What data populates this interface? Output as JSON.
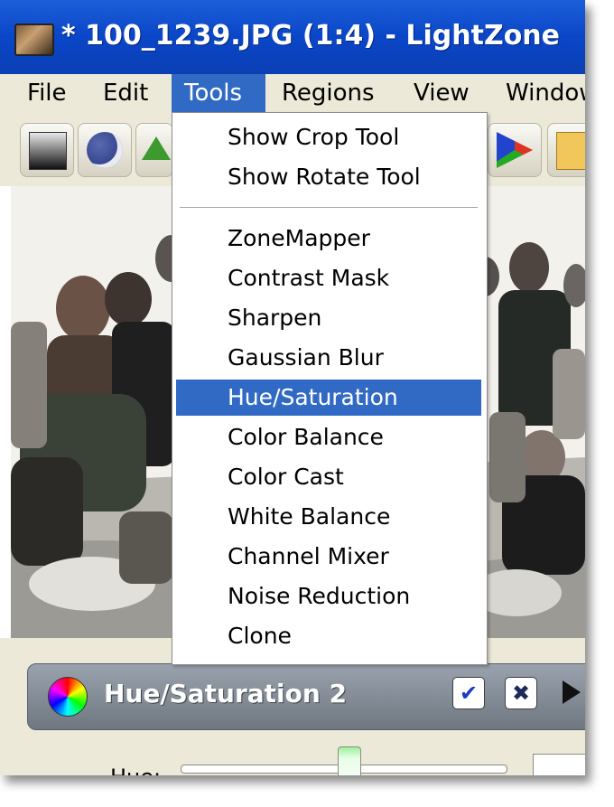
{
  "window": {
    "title": "* 100_1239.JPG (1:4) - LightZone"
  },
  "menubar": {
    "items": [
      {
        "label": "File"
      },
      {
        "label": "Edit"
      },
      {
        "label": "Tools"
      },
      {
        "label": "Regions"
      },
      {
        "label": "View"
      },
      {
        "label": "Window"
      }
    ],
    "open_menu": "Tools"
  },
  "tools_menu": {
    "items": [
      {
        "label": "Show Crop Tool"
      },
      {
        "label": "Show Rotate Tool"
      },
      {
        "label": "ZoneMapper"
      },
      {
        "label": "Contrast Mask"
      },
      {
        "label": "Sharpen"
      },
      {
        "label": "Gaussian Blur"
      },
      {
        "label": "Hue/Saturation"
      },
      {
        "label": "Color Balance"
      },
      {
        "label": "Color Cast"
      },
      {
        "label": "White Balance"
      },
      {
        "label": "Channel Mixer"
      },
      {
        "label": "Noise Reduction"
      },
      {
        "label": "Clone"
      }
    ],
    "highlighted": "Hue/Saturation"
  },
  "toolbar": {
    "buttons": [
      {
        "icon": "zonemapper-icon"
      },
      {
        "icon": "contrast-mask-icon"
      },
      {
        "icon": "sharpen-icon"
      },
      {
        "icon": "channel-mixer-icon"
      },
      {
        "icon": "color-swatch-icon"
      }
    ]
  },
  "tool_panel": {
    "title": "Hue/Saturation 2",
    "enable_symbol": "✔",
    "close_symbol": "✖",
    "hue_label": "Hue:"
  },
  "colors": {
    "titlebar": "#0a46c8",
    "menu_highlight": "#316ac5",
    "chrome": "#ece9d8"
  }
}
